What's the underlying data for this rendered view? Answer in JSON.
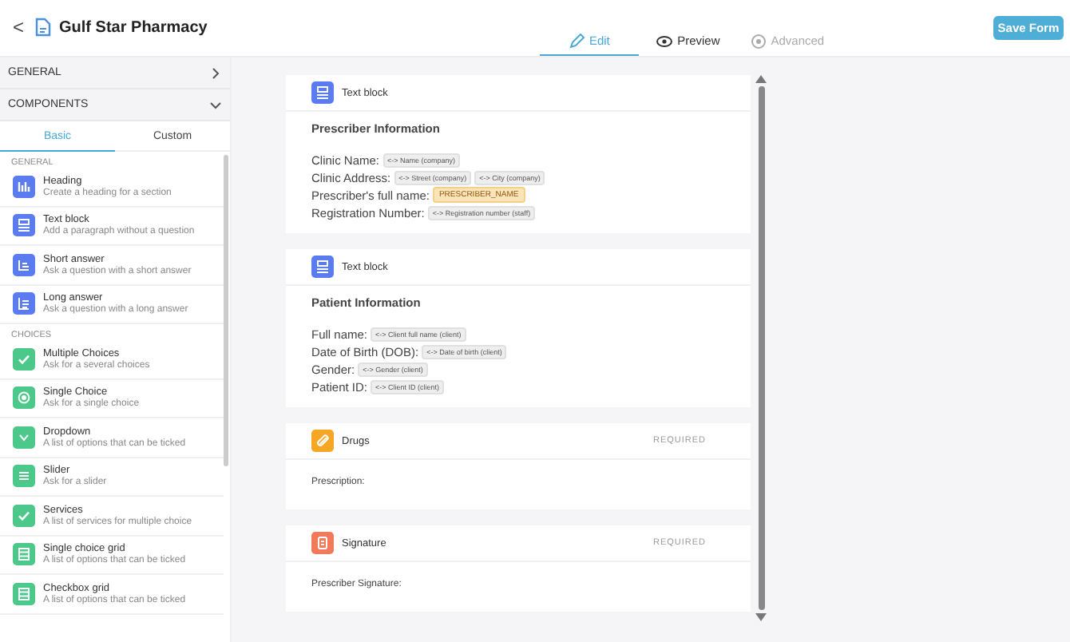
{
  "header": {
    "back": "<",
    "title": "Gulf Star Pharmacy",
    "save_button": "Save Form"
  },
  "mode_tabs": [
    {
      "label": "Edit",
      "kind": "edit",
      "selected": true,
      "disabled": false
    },
    {
      "label": "Preview",
      "kind": "preview",
      "selected": false,
      "disabled": false
    },
    {
      "label": "Advanced",
      "kind": "advanced",
      "selected": false,
      "disabled": true
    }
  ],
  "sidebar": {
    "sections": [
      {
        "label": "GENERAL",
        "expanded": false
      },
      {
        "label": "COMPONENTS",
        "expanded": true
      }
    ],
    "tabs": [
      {
        "label": "Basic",
        "selected": true
      },
      {
        "label": "Custom",
        "selected": false
      }
    ],
    "groups": [
      {
        "label": "GENERAL",
        "items": [
          {
            "kind": "heading",
            "color": "#5b7cf0",
            "title": "Heading",
            "description": "Create a heading for a section"
          },
          {
            "kind": "text",
            "color": "#5b7cf0",
            "title": "Text block",
            "description": "Add a paragraph without a question"
          },
          {
            "kind": "short",
            "color": "#5b7cf0",
            "title": "Short answer",
            "description": "Ask a question with a short answer"
          },
          {
            "kind": "long",
            "color": "#5b7cf0",
            "title": "Long answer",
            "description": "Ask a question with a long answer"
          }
        ]
      },
      {
        "label": "CHOICES",
        "items": [
          {
            "kind": "check",
            "color": "#4cc98a",
            "title": "Multiple Choices",
            "description": "Ask for a several choices"
          },
          {
            "kind": "radio",
            "color": "#4cc98a",
            "title": "Single Choice",
            "description": "Ask for a single choice"
          },
          {
            "kind": "dropdown",
            "color": "#4cc98a",
            "title": "Dropdown",
            "description": "A list of options that can be ticked"
          },
          {
            "kind": "slider",
            "color": "#4cc98a",
            "title": "Slider",
            "description": "Ask for a slider"
          },
          {
            "kind": "check",
            "color": "#4cc98a",
            "title": "Services",
            "description": "A list of services for multiple choice"
          },
          {
            "kind": "grid",
            "color": "#4cc98a",
            "title": "Single choice grid",
            "description": "A list of options that can be ticked"
          },
          {
            "kind": "grid",
            "color": "#4cc98a",
            "title": "Checkbox grid",
            "description": "A list of options that can be ticked"
          }
        ]
      }
    ]
  },
  "cards": [
    {
      "kind": "text",
      "color": "#5b7cf0",
      "title": "Text block",
      "heading": "Prescriber Information",
      "lines": [
        {
          "label": "Clinic Name:",
          "tags": [
            {
              "kind": "variable",
              "text": "<-> Name (company)"
            }
          ]
        },
        {
          "label": "Clinic Address:",
          "tags": [
            {
              "kind": "variable",
              "text": "<-> Street (company)"
            },
            {
              "kind": "variable",
              "text": "<-> City (company)"
            }
          ]
        },
        {
          "label": "Prescriber's full name:",
          "tags": [
            {
              "kind": "placeholder",
              "text": "PRESCRIBER_NAME"
            }
          ]
        },
        {
          "label": "Registration Number:",
          "tags": [
            {
              "kind": "variable",
              "text": "<-> Registration number (staff)"
            }
          ]
        }
      ]
    },
    {
      "kind": "text",
      "color": "#5b7cf0",
      "title": "Text block",
      "heading": "Patient Information",
      "lines": [
        {
          "label": "Full name:",
          "tags": [
            {
              "kind": "variable",
              "text": "<-> Client full name (client)"
            }
          ]
        },
        {
          "label": "Date of Birth (DOB):",
          "tags": [
            {
              "kind": "variable",
              "text": "<-> Date of birth (client)"
            }
          ]
        },
        {
          "label": "Gender:",
          "tags": [
            {
              "kind": "variable",
              "text": "<-> Gender (client)"
            }
          ]
        },
        {
          "label": "Patient ID:",
          "tags": [
            {
              "kind": "variable",
              "text": "<-> Client ID (client)"
            }
          ]
        }
      ]
    },
    {
      "kind": "drugs",
      "color": "#f5a623",
      "title": "Drugs",
      "required": "REQUIRED",
      "field_label": "Prescription:"
    },
    {
      "kind": "signature",
      "color": "#f07a5a",
      "title": "Signature",
      "required": "REQUIRED",
      "field_label": "Prescriber Signature:"
    }
  ]
}
